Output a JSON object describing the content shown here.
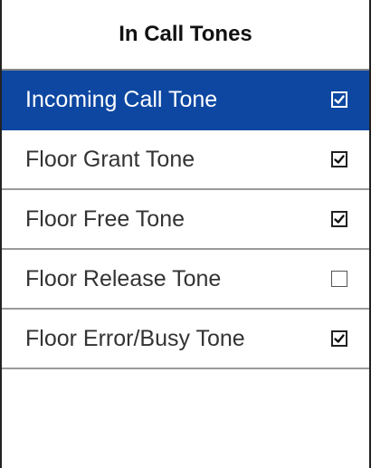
{
  "header": {
    "title": "In Call Tones"
  },
  "items": [
    {
      "label": "Incoming Call Tone",
      "checked": true,
      "selected": true
    },
    {
      "label": "Floor Grant Tone",
      "checked": true,
      "selected": false
    },
    {
      "label": "Floor Free Tone",
      "checked": true,
      "selected": false
    },
    {
      "label": "Floor Release Tone",
      "checked": false,
      "selected": false
    },
    {
      "label": "Floor Error/Busy Tone",
      "checked": true,
      "selected": false
    }
  ],
  "colors": {
    "selected_bg": "#0d47a1",
    "text": "#333333"
  }
}
